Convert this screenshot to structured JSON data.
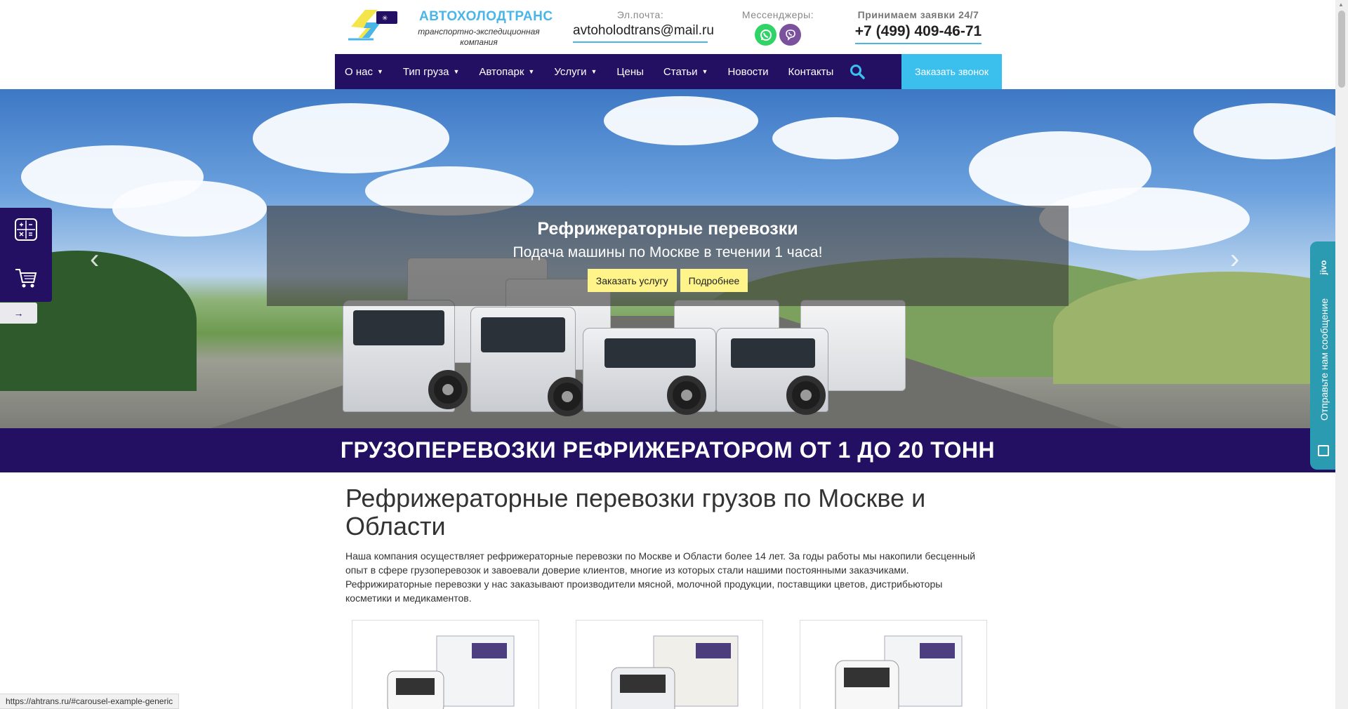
{
  "brand": {
    "name": "АВТОХОЛОДТРАНС",
    "tagline": "транспортно-экспедиционная компания",
    "accent": "#3bc0ee",
    "primary": "#231062"
  },
  "header": {
    "email_label": "Эл.почта:",
    "email": "avtoholodtrans@mail.ru",
    "messengers_label": "Мессенджеры:",
    "messengers": [
      "whatsapp-icon",
      "viber-icon"
    ],
    "phone_label": "Принимаем заявки 24/7",
    "phone": "+7 (499) 409-46-71"
  },
  "nav": {
    "items": [
      {
        "label": "О нас",
        "dropdown": true
      },
      {
        "label": "Тип груза",
        "dropdown": true
      },
      {
        "label": "Автопарк",
        "dropdown": true
      },
      {
        "label": "Услуги",
        "dropdown": true
      },
      {
        "label": "Цены",
        "dropdown": false
      },
      {
        "label": "Статьи",
        "dropdown": true
      },
      {
        "label": "Новости",
        "dropdown": false
      },
      {
        "label": "Контакты",
        "dropdown": false
      }
    ],
    "search_icon": "search-icon",
    "cta": "Заказать звонок"
  },
  "hero": {
    "title": "Рефрижераторные перевозки",
    "subtitle": "Подача машины по Москве в течении 1 часа!",
    "button_order": "Заказать услугу",
    "button_more": "Подробнее",
    "prev_icon": "chevron-left-icon",
    "next_icon": "chevron-right-icon"
  },
  "banner": {
    "text": "ГРУЗОПЕРЕВОЗКИ РЕФРИЖЕРАТОРОМ ОТ 1 ДО 20 ТОНН"
  },
  "content": {
    "heading": "Рефрижераторные перевозки грузов по Москве и Области",
    "paragraph": "Наша компания осуществляет рефрижераторные перевозки по Москве и Области более 14 лет. За годы работы мы накопили бесценный опыт в сфере грузоперевозок и завоевали доверие клиентов, многие из которых стали нашими постоянными заказчиками. Рефрижираторные перевозки у нас заказывают производители мясной, молочной продукции, поставщики цветов, дистрибьюторы косметики и медикаментов."
  },
  "side_tools": {
    "items": [
      "calculator-icon",
      "cart-icon"
    ],
    "toggle": "→"
  },
  "chat_widget": {
    "logo": "jivo",
    "text": "Отправьте нам сообщение"
  },
  "statusbar": {
    "url": "https://ahtrans.ru/#carousel-example-generic"
  }
}
